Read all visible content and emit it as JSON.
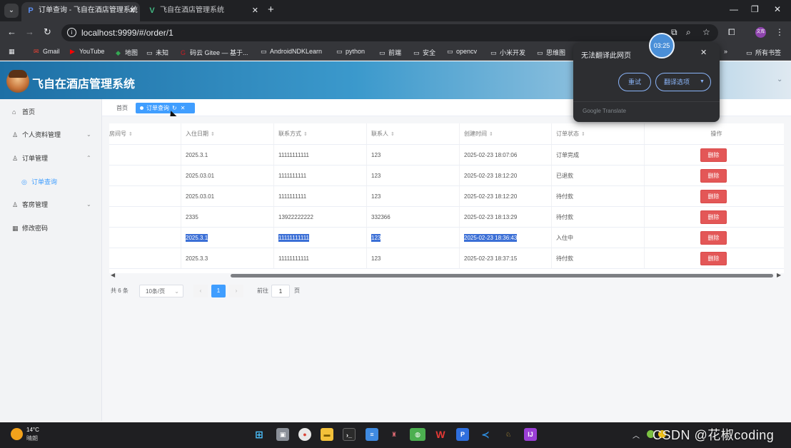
{
  "browser": {
    "tabs": [
      {
        "title": "订单查询 - 飞自在酒店管理系统",
        "favicon": "P",
        "active": true
      },
      {
        "title": "飞自在酒店管理系统",
        "favicon": "V",
        "active": false
      }
    ],
    "new_tab": "+",
    "url": "localhost:9999/#/order/1",
    "bookmarks": [
      {
        "label": "Gmail",
        "icon": "gmail-icon"
      },
      {
        "label": "YouTube",
        "icon": "youtube-icon"
      },
      {
        "label": "地图",
        "icon": "maps-icon"
      },
      {
        "label": "未知",
        "icon": "folder-icon"
      },
      {
        "label": "码云 Gitee — 基于...",
        "icon": "gitee-icon"
      },
      {
        "label": "AndroidNDKLearn",
        "icon": "folder-icon"
      },
      {
        "label": "python",
        "icon": "folder-icon"
      },
      {
        "label": "前端",
        "icon": "folder-icon"
      },
      {
        "label": "安全",
        "icon": "folder-icon"
      },
      {
        "label": "opencv",
        "icon": "folder-icon"
      },
      {
        "label": "小米开发",
        "icon": "folder-icon"
      },
      {
        "label": "思维图",
        "icon": "folder-icon"
      }
    ],
    "all_bookmarks": "所有书签",
    "bookmarks_overflow": "»",
    "profile_badge": "文库"
  },
  "translate_popup": {
    "title": "无法翻译此网页",
    "retry": "重试",
    "options": "翻译选项",
    "footer": "Google Translate"
  },
  "timer": "03:25",
  "app": {
    "title": "飞自在酒店管理系统"
  },
  "sidebar": {
    "items": [
      {
        "label": "首页",
        "icon": "home-icon",
        "arrow": ""
      },
      {
        "label": "个人资料管理",
        "icon": "user-icon",
        "arrow": "⌄"
      },
      {
        "label": "订单管理",
        "icon": "order-icon",
        "arrow": "⌃"
      },
      {
        "label": "订单查询",
        "icon": "search-icon",
        "arrow": ""
      },
      {
        "label": "客房管理",
        "icon": "room-icon",
        "arrow": "⌄"
      },
      {
        "label": "修改密码",
        "icon": "password-icon",
        "arrow": ""
      }
    ]
  },
  "tags": {
    "home": "首页",
    "current": "订单查询"
  },
  "table": {
    "headers": [
      "房间号",
      "入住日期",
      "联系方式",
      "联系人",
      "创建时间",
      "订单状态",
      "操作"
    ],
    "rows": [
      {
        "checkin": "2025.3.1",
        "phone": "11111111111",
        "contact": "123",
        "created": "2025-02-23 18:07:06",
        "status": "订单完成"
      },
      {
        "checkin": "2025.03.01",
        "phone": "1111111111",
        "contact": "123",
        "created": "2025-02-23 18:12:20",
        "status": "已退款"
      },
      {
        "checkin": "2025.03.01",
        "phone": "1111111111",
        "contact": "123",
        "created": "2025-02-23 18:12:20",
        "status": "待付款"
      },
      {
        "checkin": "2335",
        "phone": "13922222222",
        "contact": "332366",
        "created": "2025-02-23 18:13:29",
        "status": "待付款"
      },
      {
        "checkin": "2025.3.1",
        "phone": "11111111111",
        "contact": "123",
        "created": "2025-02-23 18:36:43",
        "status": "入住中"
      },
      {
        "checkin": "2025.3.3",
        "phone": "11111111111",
        "contact": "123",
        "created": "2025-02-23 18:37:15",
        "status": "待付款"
      }
    ],
    "delete_label": "删除"
  },
  "pagination": {
    "total": "共 6 条",
    "page_size": "10条/页",
    "prev": "‹",
    "current": "1",
    "next": "›",
    "goto_prefix": "前往",
    "goto_value": "1",
    "goto_suffix": "页"
  },
  "taskbar": {
    "temp": "14°C",
    "weather": "晴朗"
  },
  "watermark": "CSDN @花椒coding"
}
